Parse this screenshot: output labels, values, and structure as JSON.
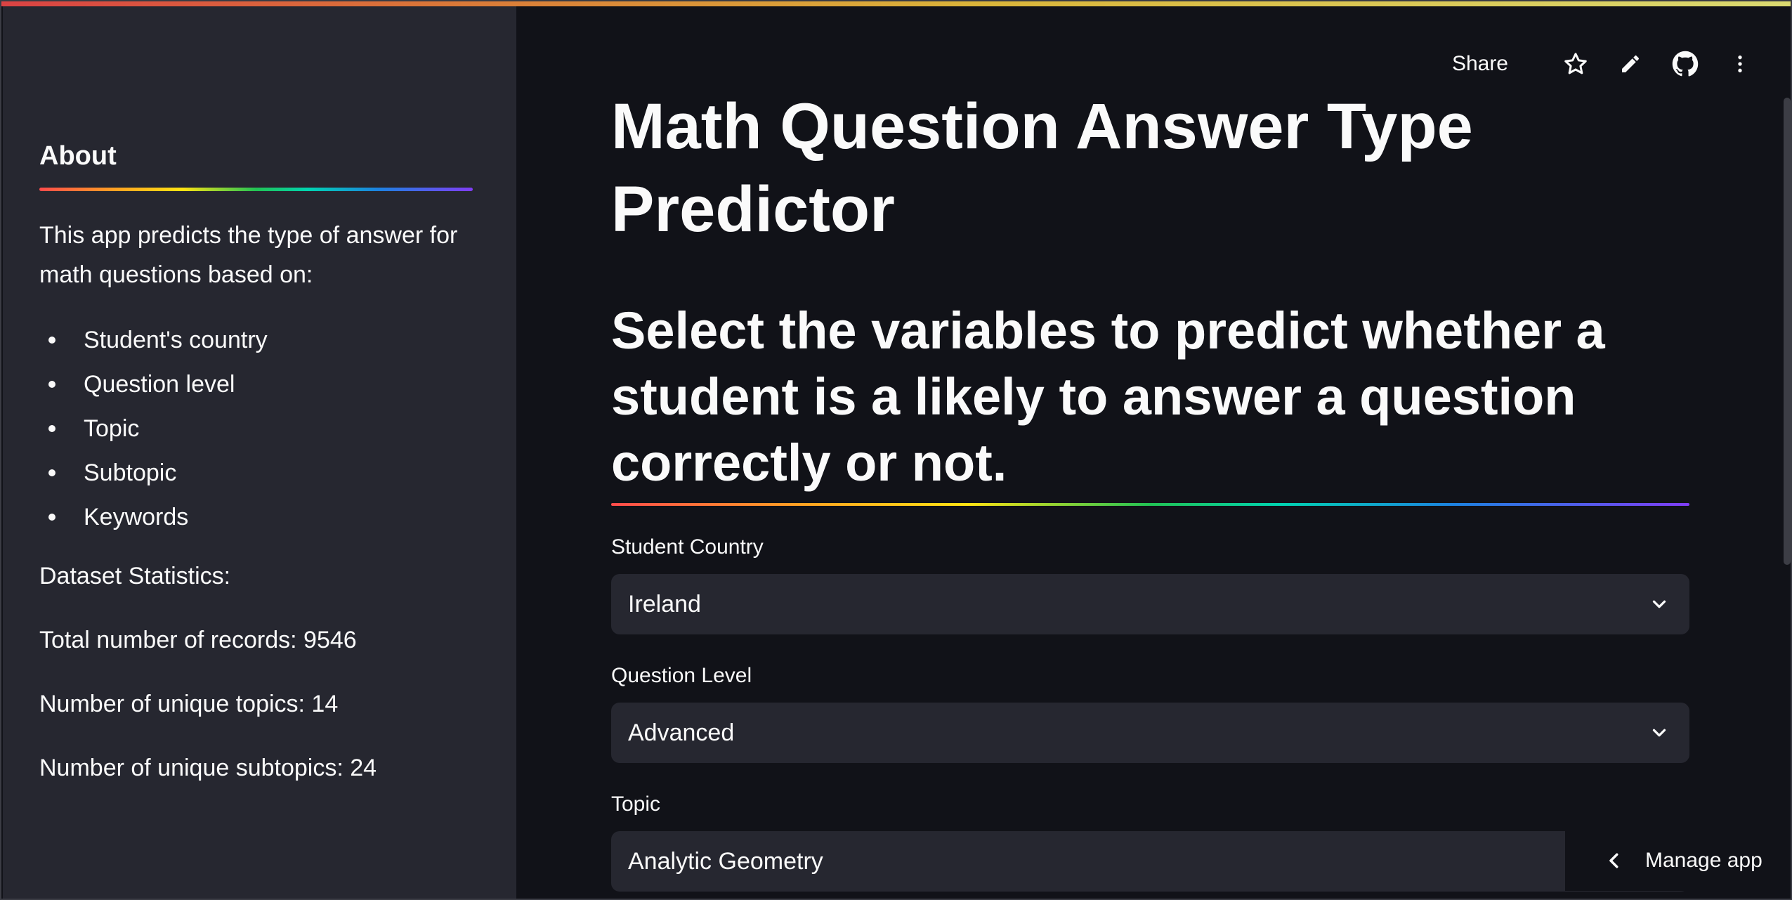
{
  "sidebar": {
    "about_title": "About",
    "description": "This app predicts the type of answer for math questions based on:",
    "items": [
      {
        "label": "Student's country"
      },
      {
        "label": "Question level"
      },
      {
        "label": "Topic"
      },
      {
        "label": "Subtopic"
      },
      {
        "label": "Keywords"
      }
    ],
    "dataset_heading": "Dataset Statistics:",
    "total_records": "Total number of records: 9546",
    "unique_topics": "Number of unique topics: 14",
    "unique_subtopics": "Number of unique subtopics: 24"
  },
  "toolbar": {
    "share_label": "Share",
    "icons": [
      "star-icon",
      "pencil-icon",
      "github-icon",
      "more-vert-icon"
    ]
  },
  "main": {
    "title": "Math Question Answer Type Predictor",
    "subtitle": "Select the variables to predict whether a student is a likely to answer a question correctly or not.",
    "fields": [
      {
        "label": "Student Country",
        "value": "Ireland"
      },
      {
        "label": "Question Level",
        "value": "Advanced"
      },
      {
        "label": "Topic",
        "value": "Analytic Geometry"
      }
    ]
  },
  "manage_app": {
    "label": "Manage app"
  },
  "colors": {
    "background": "#111218",
    "sidebar": "#262730",
    "input": "#262730",
    "text": "#fafafa"
  }
}
